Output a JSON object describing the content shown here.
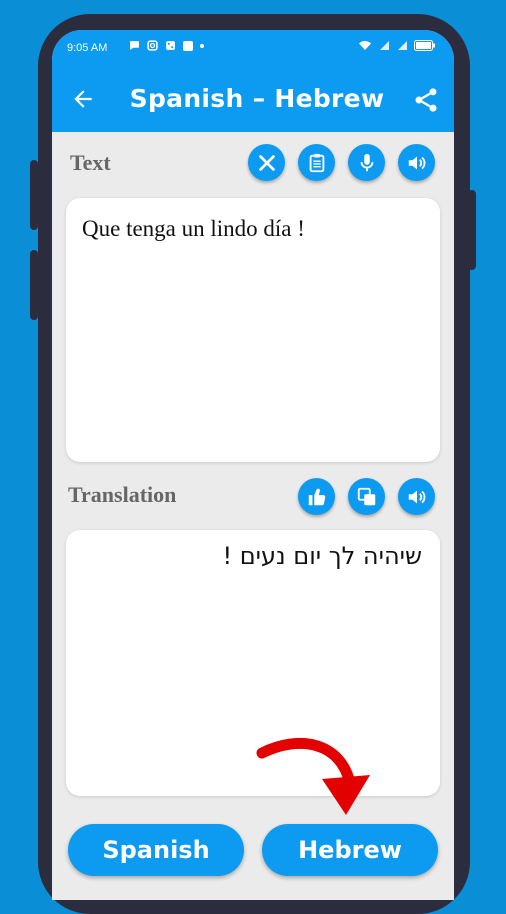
{
  "status_bar": {
    "time": "9:05 AM",
    "battery": "90"
  },
  "app_bar": {
    "title": "Spanish – Hebrew"
  },
  "source_section": {
    "label": "Text",
    "text": "Que tenga un lindo día !"
  },
  "translation_section": {
    "label": "Translation",
    "text": "שיהיה לך יום נעים !"
  },
  "bottom": {
    "source_language": "Spanish",
    "target_language": "Hebrew"
  },
  "colors": {
    "background": "#0a8fd6",
    "accent": "#0c9bf0",
    "screen": "#ebebeb",
    "arrow": "#e30000"
  },
  "icons": {
    "status": [
      "chat-icon",
      "instagram-icon",
      "dice-icon",
      "square-icon",
      "dot-icon",
      "wifi-icon",
      "signal-icon",
      "battery-icon"
    ],
    "app_bar": [
      "back-arrow-icon",
      "share-icon"
    ],
    "source_actions": [
      "clear-icon",
      "clipboard-icon",
      "microphone-icon",
      "speaker-icon"
    ],
    "translation_actions": [
      "thumbs-up-icon",
      "copy-icon",
      "speaker-icon"
    ]
  }
}
